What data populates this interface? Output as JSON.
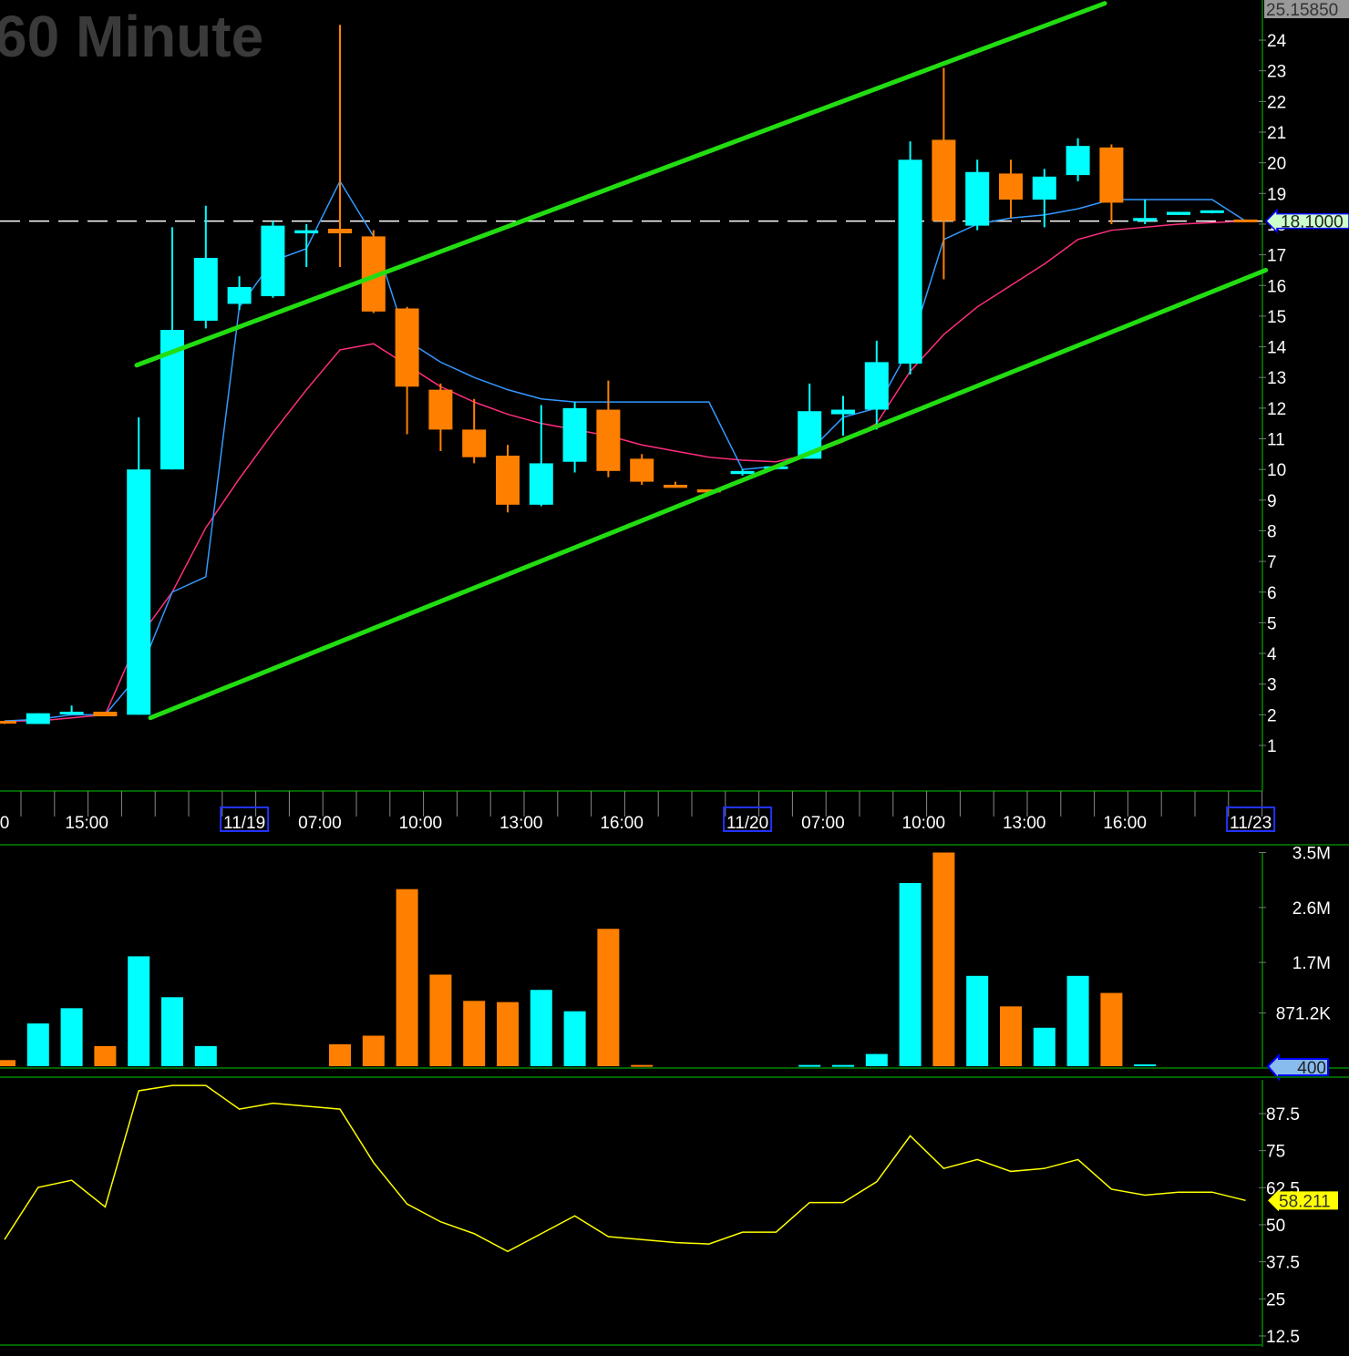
{
  "title": "60 Minute",
  "colors": {
    "up": "#00ffff",
    "down": "#ff8000",
    "fast_ma": "#3399ff",
    "slow_ma": "#ff2e7e",
    "trend": "#22dd11",
    "rsi": "#ffff00",
    "axis": "#006400"
  },
  "chart_data": [
    {
      "type": "candlestick",
      "title": "60 Minute",
      "ylim": [
        0,
        25.5
      ],
      "y_ticks": [
        "1",
        "2",
        "3",
        "4",
        "5",
        "6",
        "7",
        "8",
        "9",
        "10",
        "11",
        "12",
        "13",
        "14",
        "15",
        "16",
        "17",
        "18",
        "19",
        "20",
        "21",
        "22",
        "23",
        "24"
      ],
      "top_price_label": "25.15850",
      "last_price_label": "18.1000",
      "last_price": 18.1,
      "x_labels": [
        {
          "bar": 0,
          "text": "0",
          "boxed": false
        },
        {
          "bar": 2.45,
          "text": "15:00",
          "boxed": false
        },
        {
          "bar": 7.15,
          "text": "11/19",
          "boxed": true
        },
        {
          "bar": 9.4,
          "text": "07:00",
          "boxed": false
        },
        {
          "bar": 12.4,
          "text": "10:00",
          "boxed": false
        },
        {
          "bar": 15.4,
          "text": "13:00",
          "boxed": false
        },
        {
          "bar": 18.4,
          "text": "16:00",
          "boxed": false
        },
        {
          "bar": 22.15,
          "text": "11/20",
          "boxed": true
        },
        {
          "bar": 24.4,
          "text": "07:00",
          "boxed": false
        },
        {
          "bar": 27.4,
          "text": "10:00",
          "boxed": false
        },
        {
          "bar": 30.4,
          "text": "13:00",
          "boxed": false
        },
        {
          "bar": 33.4,
          "text": "16:00",
          "boxed": false
        },
        {
          "bar": 37.15,
          "text": "11/23",
          "boxed": true
        }
      ],
      "ohlc": [
        [
          1.8,
          1.8,
          1.7,
          1.75
        ],
        [
          1.7,
          2.05,
          1.7,
          2.05
        ],
        [
          2.05,
          2.3,
          2.0,
          2.1
        ],
        [
          2.1,
          2.1,
          1.95,
          1.95
        ],
        [
          2.0,
          11.7,
          2.0,
          10.0
        ],
        [
          10.0,
          17.9,
          10.0,
          14.55
        ],
        [
          14.85,
          18.6,
          14.6,
          16.9
        ],
        [
          15.4,
          16.3,
          15.2,
          15.95
        ],
        [
          15.65,
          18.1,
          15.6,
          17.95
        ],
        [
          17.7,
          18.0,
          16.6,
          17.8
        ],
        [
          17.85,
          24.5,
          16.6,
          17.7
        ],
        [
          17.6,
          17.8,
          15.1,
          15.15
        ],
        [
          15.25,
          15.3,
          11.15,
          12.7
        ],
        [
          12.6,
          12.8,
          10.6,
          11.3
        ],
        [
          11.3,
          12.3,
          10.2,
          10.4
        ],
        [
          10.45,
          10.8,
          8.6,
          8.85
        ],
        [
          8.85,
          12.1,
          8.8,
          10.2
        ],
        [
          10.25,
          12.2,
          9.9,
          12.0
        ],
        [
          11.95,
          12.9,
          9.75,
          9.95
        ],
        [
          10.35,
          10.5,
          9.5,
          9.6
        ],
        [
          9.5,
          9.6,
          9.4,
          9.4
        ],
        [
          9.35,
          9.35,
          9.25,
          9.25
        ],
        [
          9.85,
          10.0,
          9.8,
          9.95
        ],
        [
          10.05,
          10.1,
          10.0,
          10.1
        ],
        [
          10.35,
          12.8,
          10.35,
          11.9
        ],
        [
          11.8,
          12.4,
          11.1,
          11.95
        ],
        [
          11.95,
          14.2,
          11.3,
          13.5
        ],
        [
          13.45,
          20.7,
          13.1,
          20.1
        ],
        [
          20.75,
          23.1,
          16.2,
          18.1
        ],
        [
          17.95,
          20.1,
          17.8,
          19.7
        ],
        [
          19.65,
          20.1,
          18.2,
          18.8
        ],
        [
          18.8,
          19.8,
          17.9,
          19.55
        ],
        [
          19.6,
          20.8,
          19.4,
          20.55
        ],
        [
          20.5,
          20.6,
          18.0,
          18.7
        ],
        [
          18.1,
          18.8,
          18.0,
          18.2
        ],
        [
          18.3,
          18.4,
          18.3,
          18.4
        ],
        [
          18.4,
          18.45,
          18.35,
          18.45
        ],
        [
          18.15,
          18.15,
          18.1,
          18.1
        ]
      ],
      "fast_ma": [
        1.8,
        1.85,
        2.0,
        2.0,
        3.3,
        6.0,
        6.5,
        15.3,
        16.8,
        17.2,
        19.4,
        17.6,
        14.2,
        13.5,
        13.0,
        12.6,
        12.3,
        12.2,
        12.2,
        12.2,
        12.2,
        12.2,
        10.0,
        10.1,
        10.6,
        11.7,
        12.0,
        14.0,
        17.5,
        18.0,
        18.2,
        18.3,
        18.5,
        18.8,
        18.8,
        18.8,
        18.8,
        18.1
      ],
      "slow_ma": [
        1.8,
        1.8,
        1.9,
        2.0,
        4.5,
        6.0,
        8.1,
        9.7,
        11.2,
        12.6,
        13.9,
        14.1,
        13.4,
        12.7,
        12.2,
        11.8,
        11.5,
        11.3,
        11.1,
        10.8,
        10.6,
        10.4,
        10.3,
        10.25,
        10.5,
        10.9,
        11.5,
        13.2,
        14.4,
        15.3,
        16.0,
        16.7,
        17.5,
        17.8,
        17.9,
        18.0,
        18.05,
        18.1
      ],
      "trendlines": [
        {
          "name": "upper-channel",
          "from": [
            3.94,
            13.4
          ],
          "to": [
            32.8,
            25.2
          ]
        },
        {
          "name": "lower-channel",
          "from": [
            4.35,
            1.9
          ],
          "to": [
            37.6,
            16.5
          ]
        }
      ]
    },
    {
      "type": "bar",
      "title": "Volume",
      "ylim": [
        0,
        3.5
      ],
      "unit": "M",
      "y_ticks": [
        {
          "v": 3.5,
          "t": "3.5M"
        },
        {
          "v": 2.6,
          "t": "2.6M"
        },
        {
          "v": 1.7,
          "t": "1.7M"
        },
        {
          "v": 0.8712,
          "t": "871.2K"
        }
      ],
      "last_label": "400",
      "values": [
        0.1,
        0.7,
        0.95,
        0.33,
        1.8,
        1.13,
        0.33,
        0,
        0,
        0,
        0.36,
        0.5,
        2.9,
        1.5,
        1.07,
        1.05,
        1.25,
        0.9,
        2.25,
        0.02,
        0,
        0,
        0,
        0,
        0.02,
        0.02,
        0.2,
        3.0,
        3.5,
        1.48,
        0.98,
        0.63,
        1.48,
        1.2,
        0.03,
        0,
        0,
        0
      ]
    },
    {
      "type": "line",
      "title": "RSI",
      "ylim": [
        8,
        100
      ],
      "y_ticks": [
        "87.5",
        "75",
        "62.5",
        "50",
        "37.5",
        "25",
        "12.5"
      ],
      "last_label": "58.211",
      "values": [
        45,
        62.6,
        65,
        56,
        95.2,
        97,
        97,
        89,
        91,
        90,
        89,
        71,
        57,
        51,
        47,
        41,
        47,
        53,
        46,
        45,
        44,
        43.5,
        47.5,
        47.5,
        57.5,
        57.5,
        64.5,
        80,
        69,
        72,
        68,
        69,
        72,
        62,
        60,
        61,
        61,
        58.2
      ]
    }
  ]
}
